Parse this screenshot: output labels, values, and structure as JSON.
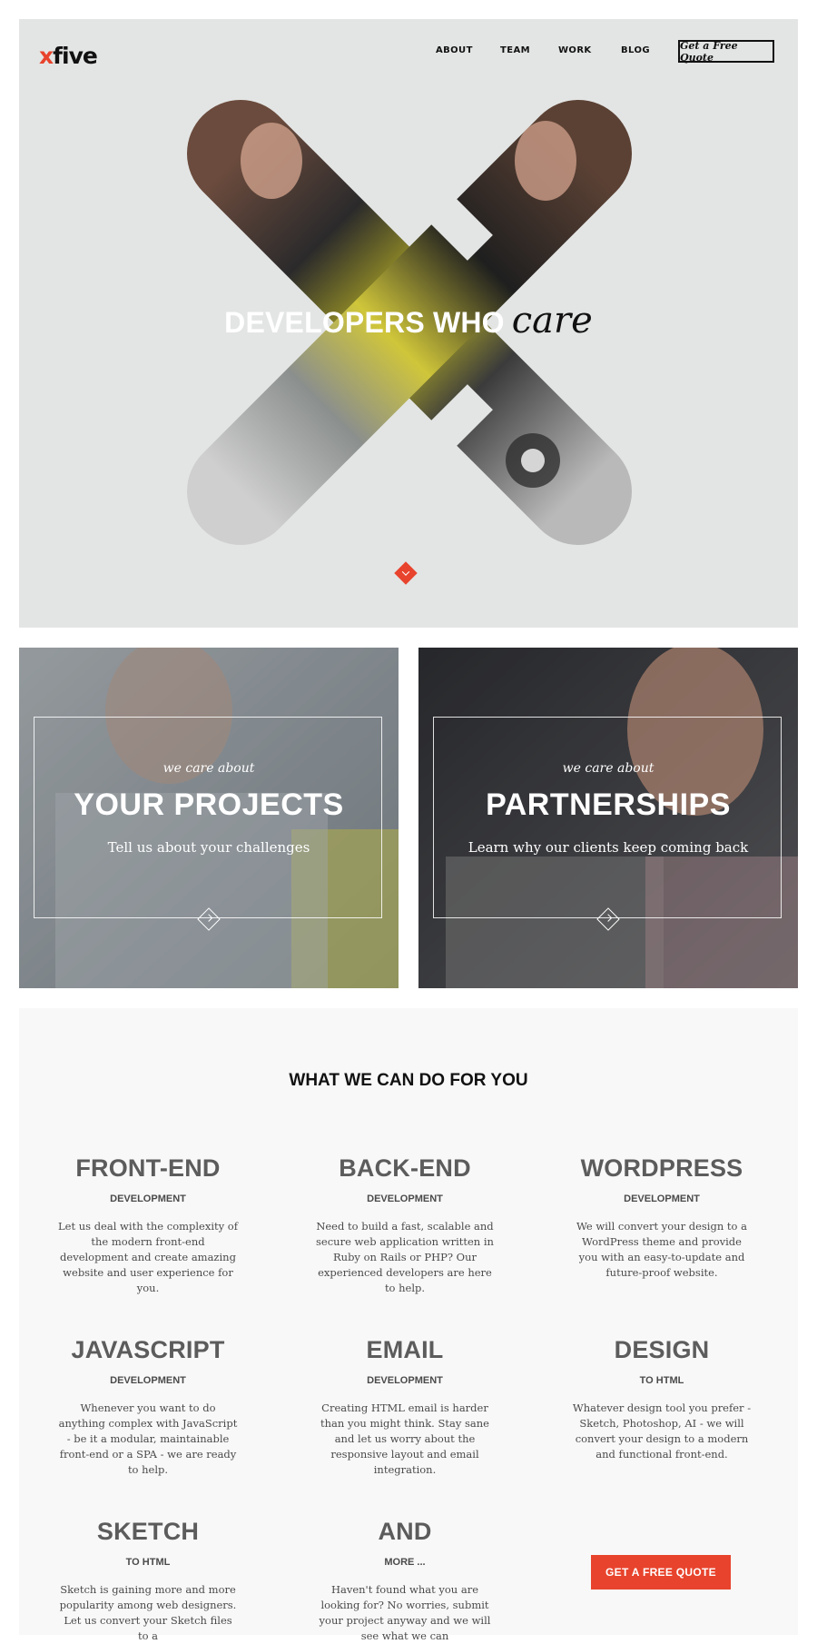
{
  "brand": {
    "logo_x": "x",
    "logo_text": "five",
    "accent": "#e8432c"
  },
  "nav": {
    "items": [
      {
        "label": "ABOUT"
      },
      {
        "label": "TEAM"
      },
      {
        "label": "WORK"
      },
      {
        "label": "BLOG"
      }
    ],
    "cta_label": "Get a Free Quote"
  },
  "hero": {
    "title_bold": "DEVELOPERS WHO",
    "title_script": "care",
    "scroll_icon": "chevron-down-icon"
  },
  "cards": [
    {
      "eyebrow": "we care about",
      "title": "YOUR PROJECTS",
      "subtitle": "Tell us about your challenges"
    },
    {
      "eyebrow": "we care about",
      "title": "PARTNERSHIPS",
      "subtitle": "Learn why our clients keep coming back"
    }
  ],
  "services": {
    "heading": "WHAT WE CAN DO FOR YOU",
    "items": [
      {
        "title": "FRONT-END",
        "subtitle": "DEVELOPMENT",
        "description": "Let us deal with the complexity of the modern front-end development and create amazing website and user experience for you."
      },
      {
        "title": "BACK-END",
        "subtitle": "DEVELOPMENT",
        "description": "Need to build a fast, scalable and secure web application written in Ruby on Rails or PHP? Our experienced developers are here to help."
      },
      {
        "title": "WORDPRESS",
        "subtitle": "DEVELOPMENT",
        "description": "We will convert your design to a WordPress theme and provide you with an easy-to-update and future-proof website."
      },
      {
        "title": "JAVASCRIPT",
        "subtitle": "DEVELOPMENT",
        "description": "Whenever you want to do anything complex with JavaScript - be it a modular, maintainable front-end or a SPA - we are ready to help."
      },
      {
        "title": "EMAIL",
        "subtitle": "DEVELOPMENT",
        "description": "Creating HTML email is harder than you might think. Stay sane and let us worry about the responsive layout and email integration."
      },
      {
        "title": "DESIGN",
        "subtitle": "TO HTML",
        "description": "Whatever design tool you prefer - Sketch, Photoshop, AI - we will convert your design to a modern and functional front-end."
      },
      {
        "title": "SKETCH",
        "subtitle": "TO HTML",
        "description": "Sketch is gaining more and more popularity among web designers. Let us convert your Sketch files to a"
      },
      {
        "title": "AND",
        "subtitle": "MORE ...",
        "description": "Haven't found what you are looking for? No worries, submit your project anyway and we will see what we can"
      }
    ],
    "cta_label": "GET A FREE QUOTE"
  }
}
